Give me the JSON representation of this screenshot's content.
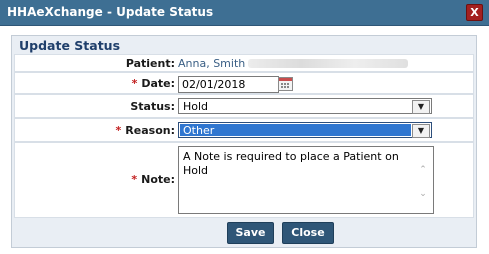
{
  "window": {
    "title": "HHAeXchange - Update Status",
    "close_label": "X"
  },
  "panel": {
    "header": "Update Status"
  },
  "form": {
    "patient_label": "Patient:",
    "patient_value": "Anna, Smith",
    "required_mark": "*",
    "date_label": "Date:",
    "date_value": "02/01/2018",
    "status_label": "Status:",
    "status_value": "Hold",
    "reason_label": "Reason:",
    "reason_value": "Other",
    "note_label": "Note:",
    "note_value": "A Note is required to place a Patient on Hold"
  },
  "buttons": {
    "save": "Save",
    "close": "Close"
  },
  "icons": {
    "calendar": "calendar-icon",
    "dropdown": "chevron-down-icon",
    "close": "close-icon"
  },
  "colors": {
    "titlebar": "#3e6f93",
    "panel_bg": "#e9eef4",
    "button": "#2f5677",
    "required": "#c21f1f",
    "selection": "#2f76d0"
  }
}
